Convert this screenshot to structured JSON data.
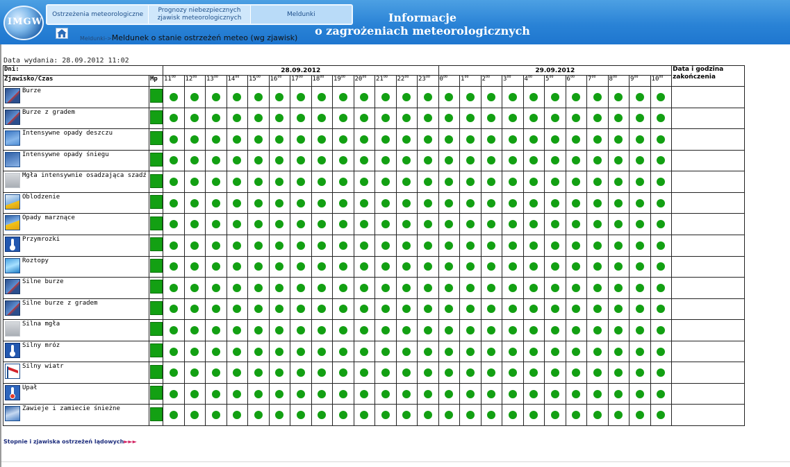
{
  "logo": {
    "text": "IMGW"
  },
  "nav": {
    "tabs": [
      {
        "label": "Ostrzeżenia meteorologiczne"
      },
      {
        "label": "Prognozy niebezpiecznych zjawisk meteorologicznych"
      },
      {
        "label": "Meldunki"
      }
    ]
  },
  "header": {
    "title_line1": "Informacje",
    "title_line2": "o zagrożeniach meteorologicznych"
  },
  "breadcrumb": {
    "parent": "Meldunki",
    "separator": "->",
    "current": "Meldunek o stanie ostrzeżeń meteo (wg zjawisk)"
  },
  "issue_date": "Data wydania: 28.09.2012 11:02",
  "table": {
    "days_label": "Dni:",
    "phenomenon_header": "Zjawisko/Czas",
    "mp_header": "Mp",
    "end_header": "Data i godzina zakończenia",
    "dates": [
      {
        "label": "28.09.2012",
        "hours": [
          "11",
          "12",
          "13",
          "14",
          "15",
          "16",
          "17",
          "18",
          "19",
          "20",
          "21",
          "22",
          "23"
        ]
      },
      {
        "label": "29.09.2012",
        "hours": [
          "0",
          "1",
          "2",
          "3",
          "4",
          "5",
          "6",
          "7",
          "8",
          "9",
          "10"
        ]
      }
    ],
    "hour_suffix": "00",
    "status_color": "#13a013",
    "rows": [
      {
        "name": "Burze",
        "icon": "storm-icon",
        "end": ""
      },
      {
        "name": "Burze z gradem",
        "icon": "hail-storm-icon",
        "end": ""
      },
      {
        "name": "Intensywne opady deszczu",
        "icon": "heavy-rain-icon",
        "end": ""
      },
      {
        "name": "Intensywne opady śniegu",
        "icon": "heavy-snow-icon",
        "end": ""
      },
      {
        "name": "Mgła intensywnie osadzająca szadź",
        "icon": "rime-fog-icon",
        "end": ""
      },
      {
        "name": "Oblodzenie",
        "icon": "icing-icon",
        "end": ""
      },
      {
        "name": "Opady marznące",
        "icon": "freezing-rain-icon",
        "end": ""
      },
      {
        "name": "Przymrozki",
        "icon": "ground-frost-icon",
        "end": ""
      },
      {
        "name": "Roztopy",
        "icon": "thaw-icon",
        "end": ""
      },
      {
        "name": "Silne burze",
        "icon": "severe-storm-icon",
        "end": ""
      },
      {
        "name": "Silne burze z gradem",
        "icon": "severe-hail-storm-icon",
        "end": ""
      },
      {
        "name": "Silna mgła",
        "icon": "dense-fog-icon",
        "end": ""
      },
      {
        "name": "Silny mróz",
        "icon": "severe-frost-icon",
        "end": ""
      },
      {
        "name": "Silny wiatr",
        "icon": "strong-wind-icon",
        "end": ""
      },
      {
        "name": "Upał",
        "icon": "heat-icon",
        "end": ""
      },
      {
        "name": "Zawieje i zamiecie śnieżne",
        "icon": "blizzard-icon",
        "end": ""
      }
    ]
  },
  "footer": {
    "link_text": "Stopnie i zjawiska ostrzeżeń lądowych",
    "arrows": "►►►"
  }
}
